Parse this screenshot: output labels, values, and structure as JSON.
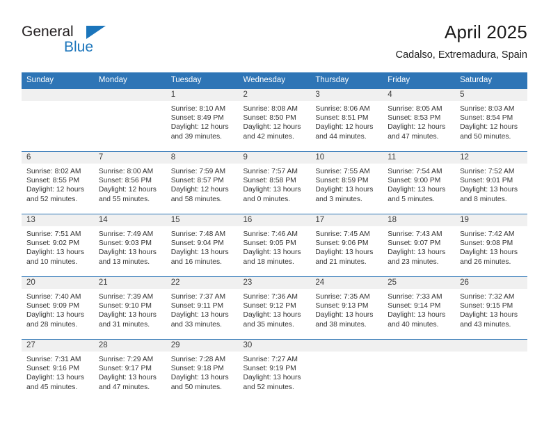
{
  "brand": {
    "name_top": "General",
    "name_bottom": "Blue",
    "triangle_color": "#1b75bb"
  },
  "header": {
    "title": "April 2025",
    "subtitle": "Cadalso, Extremadura, Spain"
  },
  "theme": {
    "header_bg": "#2e75b6",
    "daynum_bg": "#f0f0f0",
    "row_border": "#2e75b6"
  },
  "weekday_headers": [
    "Sunday",
    "Monday",
    "Tuesday",
    "Wednesday",
    "Thursday",
    "Friday",
    "Saturday"
  ],
  "weeks": [
    [
      {
        "date": "",
        "details": ""
      },
      {
        "date": "",
        "details": ""
      },
      {
        "date": "1",
        "details": "Sunrise: 8:10 AM\nSunset: 8:49 PM\nDaylight: 12 hours and 39 minutes."
      },
      {
        "date": "2",
        "details": "Sunrise: 8:08 AM\nSunset: 8:50 PM\nDaylight: 12 hours and 42 minutes."
      },
      {
        "date": "3",
        "details": "Sunrise: 8:06 AM\nSunset: 8:51 PM\nDaylight: 12 hours and 44 minutes."
      },
      {
        "date": "4",
        "details": "Sunrise: 8:05 AM\nSunset: 8:53 PM\nDaylight: 12 hours and 47 minutes."
      },
      {
        "date": "5",
        "details": "Sunrise: 8:03 AM\nSunset: 8:54 PM\nDaylight: 12 hours and 50 minutes."
      }
    ],
    [
      {
        "date": "6",
        "details": "Sunrise: 8:02 AM\nSunset: 8:55 PM\nDaylight: 12 hours and 52 minutes."
      },
      {
        "date": "7",
        "details": "Sunrise: 8:00 AM\nSunset: 8:56 PM\nDaylight: 12 hours and 55 minutes."
      },
      {
        "date": "8",
        "details": "Sunrise: 7:59 AM\nSunset: 8:57 PM\nDaylight: 12 hours and 58 minutes."
      },
      {
        "date": "9",
        "details": "Sunrise: 7:57 AM\nSunset: 8:58 PM\nDaylight: 13 hours and 0 minutes."
      },
      {
        "date": "10",
        "details": "Sunrise: 7:55 AM\nSunset: 8:59 PM\nDaylight: 13 hours and 3 minutes."
      },
      {
        "date": "11",
        "details": "Sunrise: 7:54 AM\nSunset: 9:00 PM\nDaylight: 13 hours and 5 minutes."
      },
      {
        "date": "12",
        "details": "Sunrise: 7:52 AM\nSunset: 9:01 PM\nDaylight: 13 hours and 8 minutes."
      }
    ],
    [
      {
        "date": "13",
        "details": "Sunrise: 7:51 AM\nSunset: 9:02 PM\nDaylight: 13 hours and 10 minutes."
      },
      {
        "date": "14",
        "details": "Sunrise: 7:49 AM\nSunset: 9:03 PM\nDaylight: 13 hours and 13 minutes."
      },
      {
        "date": "15",
        "details": "Sunrise: 7:48 AM\nSunset: 9:04 PM\nDaylight: 13 hours and 16 minutes."
      },
      {
        "date": "16",
        "details": "Sunrise: 7:46 AM\nSunset: 9:05 PM\nDaylight: 13 hours and 18 minutes."
      },
      {
        "date": "17",
        "details": "Sunrise: 7:45 AM\nSunset: 9:06 PM\nDaylight: 13 hours and 21 minutes."
      },
      {
        "date": "18",
        "details": "Sunrise: 7:43 AM\nSunset: 9:07 PM\nDaylight: 13 hours and 23 minutes."
      },
      {
        "date": "19",
        "details": "Sunrise: 7:42 AM\nSunset: 9:08 PM\nDaylight: 13 hours and 26 minutes."
      }
    ],
    [
      {
        "date": "20",
        "details": "Sunrise: 7:40 AM\nSunset: 9:09 PM\nDaylight: 13 hours and 28 minutes."
      },
      {
        "date": "21",
        "details": "Sunrise: 7:39 AM\nSunset: 9:10 PM\nDaylight: 13 hours and 31 minutes."
      },
      {
        "date": "22",
        "details": "Sunrise: 7:37 AM\nSunset: 9:11 PM\nDaylight: 13 hours and 33 minutes."
      },
      {
        "date": "23",
        "details": "Sunrise: 7:36 AM\nSunset: 9:12 PM\nDaylight: 13 hours and 35 minutes."
      },
      {
        "date": "24",
        "details": "Sunrise: 7:35 AM\nSunset: 9:13 PM\nDaylight: 13 hours and 38 minutes."
      },
      {
        "date": "25",
        "details": "Sunrise: 7:33 AM\nSunset: 9:14 PM\nDaylight: 13 hours and 40 minutes."
      },
      {
        "date": "26",
        "details": "Sunrise: 7:32 AM\nSunset: 9:15 PM\nDaylight: 13 hours and 43 minutes."
      }
    ],
    [
      {
        "date": "27",
        "details": "Sunrise: 7:31 AM\nSunset: 9:16 PM\nDaylight: 13 hours and 45 minutes."
      },
      {
        "date": "28",
        "details": "Sunrise: 7:29 AM\nSunset: 9:17 PM\nDaylight: 13 hours and 47 minutes."
      },
      {
        "date": "29",
        "details": "Sunrise: 7:28 AM\nSunset: 9:18 PM\nDaylight: 13 hours and 50 minutes."
      },
      {
        "date": "30",
        "details": "Sunrise: 7:27 AM\nSunset: 9:19 PM\nDaylight: 13 hours and 52 minutes."
      },
      {
        "date": "",
        "details": ""
      },
      {
        "date": "",
        "details": ""
      },
      {
        "date": "",
        "details": ""
      }
    ]
  ]
}
